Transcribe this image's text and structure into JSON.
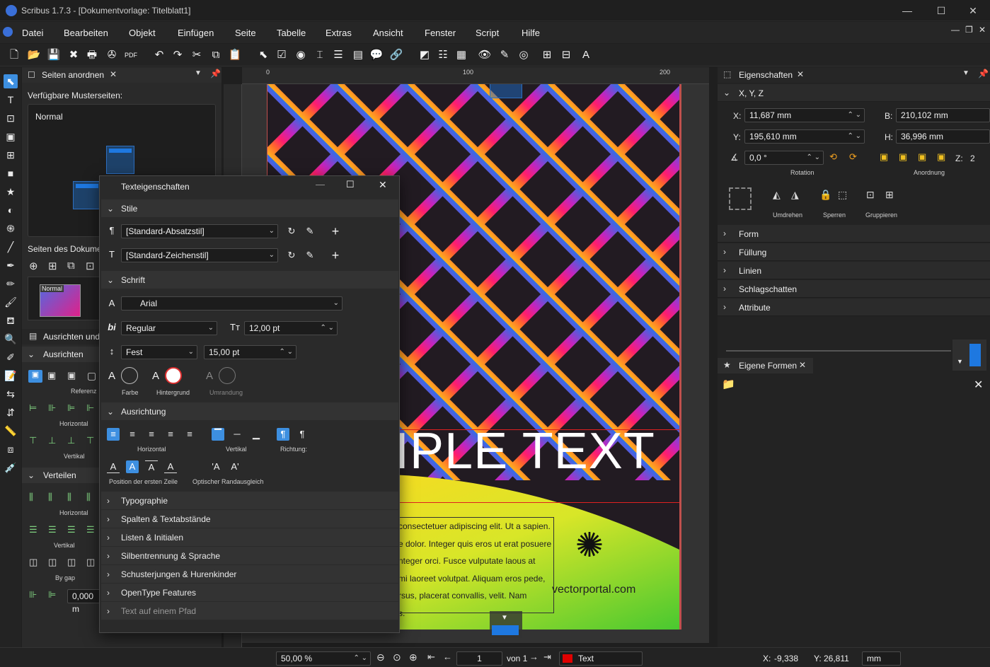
{
  "window": {
    "title": "Scribus 1.7.3 - [Dokumentvorlage: Titelblatt1]",
    "controls": {
      "minimize": "—",
      "maximize": "☐",
      "close": "✕"
    }
  },
  "menu": [
    "Datei",
    "Bearbeiten",
    "Objekt",
    "Einfügen",
    "Seite",
    "Tabelle",
    "Extras",
    "Ansicht",
    "Fenster",
    "Script",
    "Hilfe"
  ],
  "left_panel": {
    "tab_title": "Seiten anordnen",
    "masters_label": "Verfügbare Musterseiten:",
    "master_item": "Normal",
    "doc_pages_label": "Seiten des Dokume",
    "thumb_label": "Normal",
    "align_title": "Ausrichten und",
    "align_section": "Ausrichten",
    "referenz_label": "Referenz",
    "horizontal_label": "Horizontal",
    "vertikal_label": "Vertikal",
    "verteilen_section": "Verteilen",
    "horizontal_label2": "Horizontal",
    "vertikal_label2": "Vertikal",
    "bygap_label": "By gap",
    "gap_value": "0,000 m"
  },
  "text_dialog": {
    "title": "Texteigenschaften",
    "stil_section": "Stile",
    "para_style": "[Standard-Absatzstil]",
    "char_style": "[Standard-Zeichenstil]",
    "schrift_section": "Schrift",
    "font": "Arial",
    "font_style": "Regular",
    "font_size": "12,00 pt",
    "line_spacing_mode": "Fest",
    "line_spacing": "15,00 pt",
    "farbe_label": "Farbe",
    "hintergrund_label": "Hintergrund",
    "umrandung_label": "Umrandung",
    "ausrichtung_section": "Ausrichtung",
    "horizontal_label": "Horizontal",
    "vertikal_label": "Vertikal",
    "richtung_label": "Richtung:",
    "first_line_label": "Position der ersten Zeile",
    "optical_label": "Optischer Randausgleich",
    "collapsed_sections": [
      "Typographie",
      "Spalten & Textabstände",
      "Listen & Initialen",
      "Silbentrennung & Sprache",
      "Schusterjungen & Hurenkinder",
      "OpenType Features",
      "Text auf einem Pfad"
    ]
  },
  "canvas": {
    "ruler_100": "100",
    "ruler_200": "200",
    "ruler_0": "0",
    "headline": "IPLE TEXT",
    "body_lines": [
      "consectetuer adipiscing elit. Ut a sapien.",
      "e dolor. Integer quis eros ut erat posuere",
      "nteger orci. Fusce vulputate laous at",
      "mi laoreet volutpat. Aliquam eros pede,",
      "rsus, placerat convallis, velit. Nam",
      "s."
    ],
    "brand": "vectorportal.com"
  },
  "right_panel": {
    "title": "Eigenschaften",
    "xyz_section": "X, Y, Z",
    "x_label": "X:",
    "x_value": "11,687 mm",
    "y_label": "Y:",
    "y_value": "195,610 mm",
    "b_label": "B:",
    "b_value": "210,102 mm",
    "h_label": "H:",
    "h_value": "36,996 mm",
    "rotation_value": "0,0 °",
    "rotation_label": "Rotation",
    "anordnung_label": "Anordnung",
    "z_label": "Z:",
    "z_value": "2",
    "umdrehen_label": "Umdrehen",
    "sperren_label": "Sperren",
    "gruppieren_label": "Gruppieren",
    "sections": [
      "Form",
      "Füllung",
      "Linien",
      "Schlagschatten",
      "Attribute"
    ],
    "shapes_title": "Eigene Formen"
  },
  "statusbar": {
    "zoom": "50,00 %",
    "page": "1",
    "of_pages": "von 1",
    "layer": "Text",
    "x_label": "X:",
    "x_value": "-9,338",
    "y_label": "Y:",
    "y_value": "26,811",
    "unit": "mm"
  },
  "colors": {
    "accent": "#3d8fe0",
    "layer_red": "#e00000",
    "page_border": "#c0504d"
  }
}
